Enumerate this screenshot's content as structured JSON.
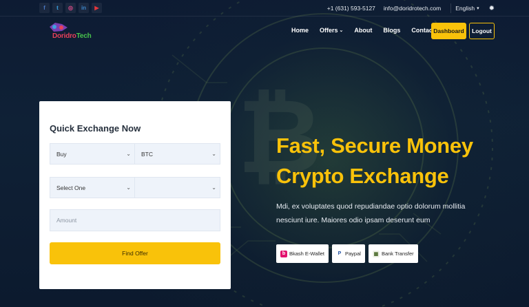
{
  "topbar": {
    "socials": [
      {
        "icon": "facebook-icon",
        "glyph": "f",
        "color": "#4a79c6"
      },
      {
        "icon": "twitter-icon",
        "glyph": "t",
        "color": "#3aa6e8"
      },
      {
        "icon": "instagram-icon",
        "glyph": "◎",
        "color": "#e24d8a"
      },
      {
        "icon": "linkedin-icon",
        "glyph": "in",
        "color": "#3c84c7"
      },
      {
        "icon": "youtube-icon",
        "glyph": "▶",
        "color": "#e5373c"
      }
    ],
    "phone": "+1 (631) 593-5127",
    "email": "info@doridrotech.com",
    "language": "English"
  },
  "logo": {
    "part1": "Doridro",
    "part2": "Tech"
  },
  "nav": {
    "home": "Home",
    "offers": "Offers",
    "about": "About",
    "blogs": "Blogs",
    "contact": "Contact",
    "dashboard": "Dashboard",
    "logout": "Logout"
  },
  "form": {
    "title": "Quick Exchange Now",
    "type_value": "Buy",
    "currency_value": "BTC",
    "method_value": "Select One",
    "second_method_value": "",
    "amount_placeholder": "Amount",
    "submit_label": "Find Offer"
  },
  "hero": {
    "title_line1": "Fast, Secure Money",
    "title_line2": "Crypto Exchange",
    "description": "Mdi, ex voluptates quod repudiandae optio dolorum mollitia nesciunt iure. Maiores odio ipsam deserunt eum"
  },
  "payments": [
    {
      "label": "Bkash E-Wallet",
      "icon": "bkash-icon"
    },
    {
      "label": "Paypal",
      "icon": "paypal-icon"
    },
    {
      "label": "Bank Transfer",
      "icon": "bank-icon"
    }
  ],
  "colors": {
    "accent": "#f9c20a",
    "background": "#0b1830"
  }
}
